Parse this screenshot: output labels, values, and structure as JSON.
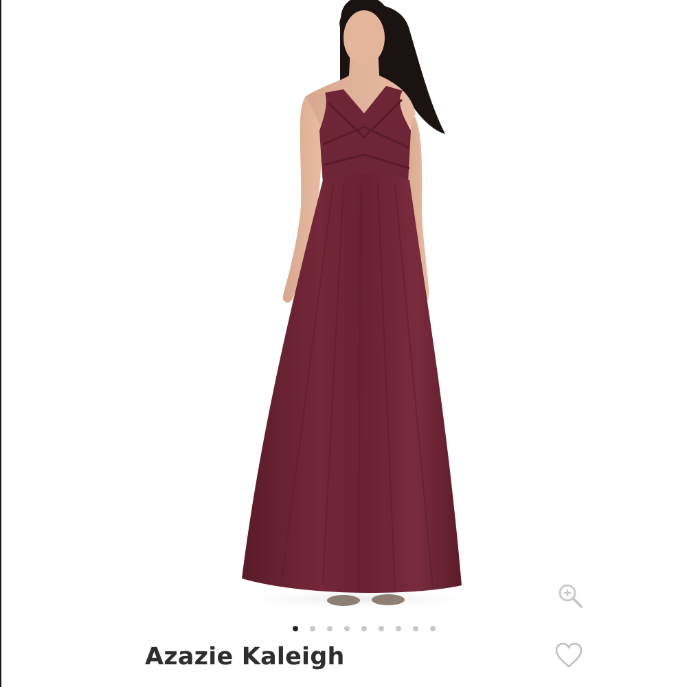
{
  "product": {
    "title": "Azazie Kaleigh",
    "image_description_icon": "dress-photo",
    "dress_color": "#6b2233"
  },
  "carousel": {
    "total_images": 9,
    "active_index": 0
  },
  "actions": {
    "zoom_icon": "zoom-in-icon",
    "favorite_icon": "heart-outline-icon"
  }
}
